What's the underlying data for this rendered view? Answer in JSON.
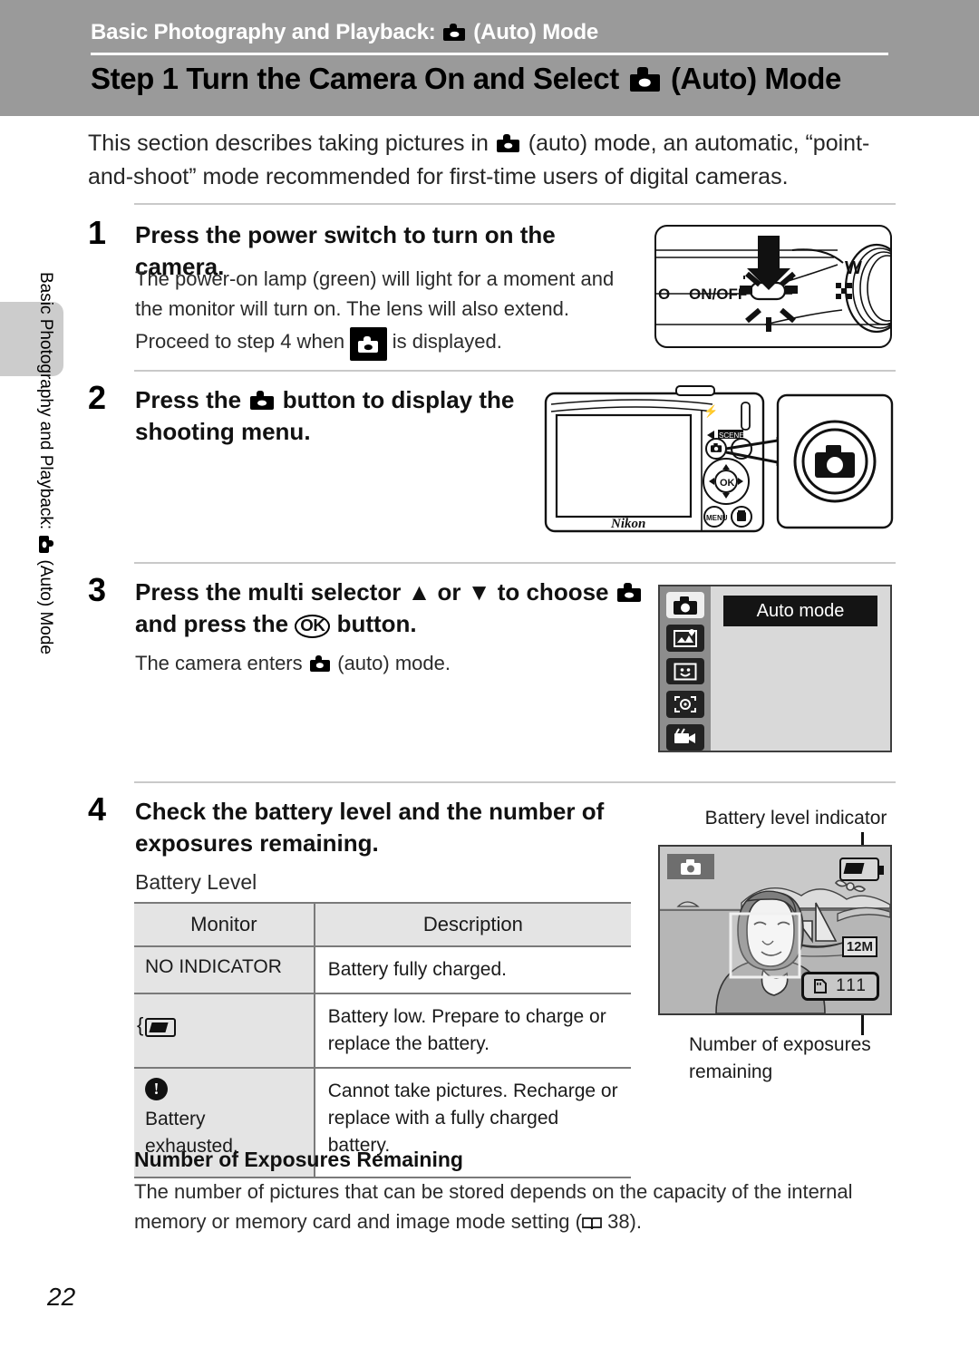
{
  "header": {
    "chapter": "Basic Photography and Playback: ",
    "chapter_tail": " (Auto) Mode",
    "title_pre": "Step 1 Turn the Camera On and Select ",
    "title_tail": " (Auto) Mode"
  },
  "sidebar": {
    "vertical_text_pre": "Basic Photography and Playback: ",
    "vertical_text_tail": " (Auto) Mode"
  },
  "intro": {
    "part1": "This section describes taking pictures in ",
    "part2": " (auto) mode, an automatic, “point-and-shoot” mode recommended for first-time users of digital cameras."
  },
  "steps": [
    {
      "number": "1",
      "heading": "Press the power switch to turn on the camera.",
      "body1": "The power-on lamp (green) will light for a moment and the monitor will turn on. The lens will also extend.",
      "body2_pre": "Proceed to step 4 when ",
      "body2_post": " is displayed."
    },
    {
      "number": "2",
      "heading_pre": "Press the ",
      "heading_post": " button to display the shooting menu."
    },
    {
      "number": "3",
      "heading_pre": "Press the multi selector ",
      "heading_up": "▲",
      "heading_or": " or ",
      "heading_down": "▼",
      "heading_mid": " to choose ",
      "heading_and": " and press the ",
      "heading_ok": "OK",
      "heading_post": " button.",
      "body_pre": "The camera enters ",
      "body_post": " (auto) mode."
    },
    {
      "number": "4",
      "heading": "Check the battery level and the number of exposures remaining.",
      "body": "Battery Level"
    }
  ],
  "camera_top": {
    "onoff_label": "ON/OFF",
    "zoom_w": "W",
    "partial_label": "O"
  },
  "camera_back": {
    "brand": "Nikon",
    "ok_label": "OK",
    "menu_label": "MENU",
    "scene_label": "SCENE"
  },
  "menu_screen": {
    "highlight": "Auto mode",
    "icons": [
      "auto-camera-icon",
      "scene-icon",
      "smart-portrait-icon",
      "subject-tracking-icon",
      "movie-icon"
    ]
  },
  "monitor": {
    "caption_top": "Battery level indicator",
    "caption_bottom": "Number of exposures remaining",
    "image_mode": "12M",
    "exposures": "111"
  },
  "battery_table": {
    "headers": [
      "Monitor",
      "Description"
    ],
    "rows": [
      {
        "monitor": "NO INDICATOR",
        "monitor_icon": "none",
        "description": "Battery fully charged."
      },
      {
        "monitor": "",
        "monitor_icon": "battery-low-icon",
        "description": "Battery low. Prepare to charge or replace the battery."
      },
      {
        "monitor": "Battery exhausted.",
        "monitor_icon": "warning-icon",
        "description": "Cannot take pictures. Recharge or replace with a fully charged battery."
      }
    ]
  },
  "footer_section": {
    "heading": "Number of Exposures Remaining",
    "body_pre": "The number of pictures that can be stored depends on the capacity of the internal memory or memory card and image mode setting (",
    "body_ref": " 38)."
  },
  "page_number": "22"
}
